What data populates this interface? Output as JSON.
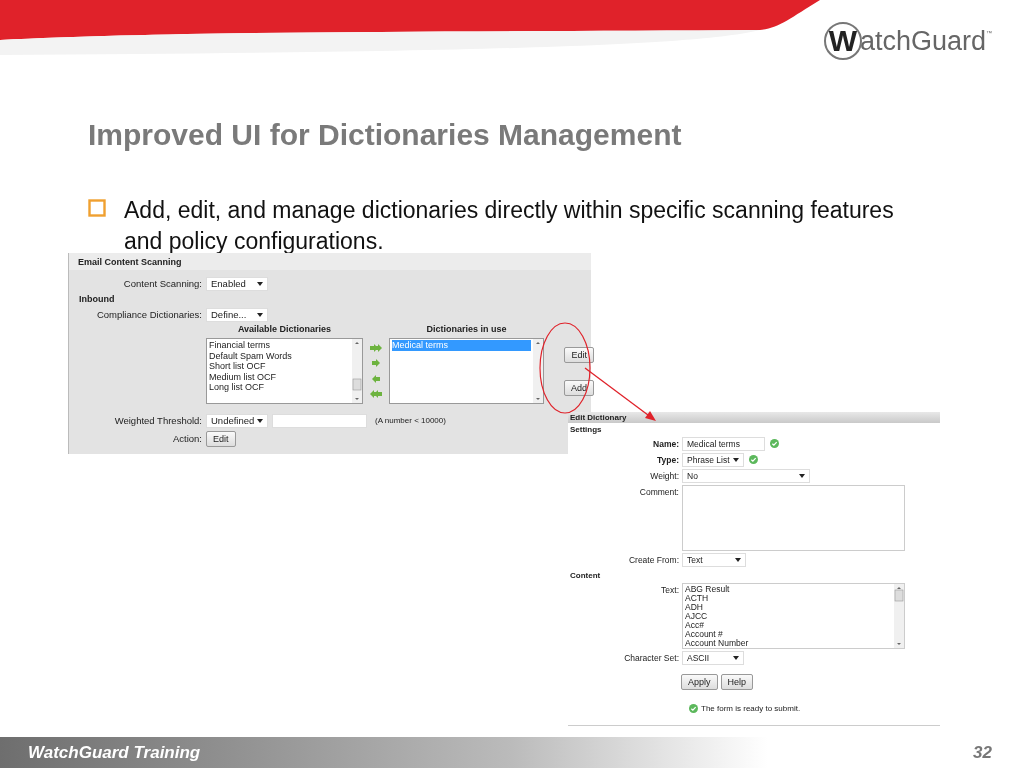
{
  "logo": {
    "letter": "W",
    "text": "atchGuard",
    "mark": "™"
  },
  "title": "Improved UI for Dictionaries Management",
  "bullet": "Add, edit, and manage dictionaries directly within specific scanning features and policy configurations.",
  "scanning": {
    "title": "Email Content Scanning",
    "rows": [
      {
        "kind": "select",
        "label": "Content Scanning:",
        "value": "Enabled"
      },
      {
        "kind": "heading",
        "label": "Inbound"
      },
      {
        "kind": "select",
        "label": "Compliance Dictionaries:",
        "value": "Define..."
      }
    ],
    "available": {
      "heading": "Available Dictionaries",
      "items": [
        {
          "label": "Financial terms",
          "selected": false
        },
        {
          "label": "Default Spam Words",
          "selected": false
        },
        {
          "label": "Short list OCF",
          "selected": false
        },
        {
          "label": "Medium list OCF",
          "selected": false
        },
        {
          "label": "Long list OCF",
          "selected": false
        }
      ]
    },
    "in_use": {
      "heading": "Dictionaries in use",
      "items": [
        {
          "label": "Medical terms",
          "selected": true
        }
      ]
    },
    "side_buttons": [
      "Edit",
      "Add"
    ],
    "threshold": {
      "label": "Weighted Threshold:",
      "value": "Undefined",
      "hint": "(A number < 10000)"
    },
    "action": {
      "label": "Action:",
      "button": "Edit"
    }
  },
  "edit": {
    "title": "Edit Dictionary",
    "settings_heading": "Settings",
    "name": {
      "label": "Name:",
      "value": "Medical terms",
      "valid": true
    },
    "type": {
      "label": "Type:",
      "value": "Phrase List",
      "valid": true
    },
    "weight": {
      "label": "Weight:",
      "value": "No"
    },
    "comment": {
      "label": "Comment:"
    },
    "create_from": {
      "label": "Create From:",
      "value": "Text"
    },
    "content_heading": "Content",
    "text": {
      "label": "Text:",
      "items": [
        "ABG Result",
        "ACTH",
        "ADH",
        "AJCC",
        "Acc#",
        "Account #",
        "Account Number"
      ]
    },
    "charset": {
      "label": "Character Set:",
      "value": "ASCII"
    },
    "buttons": [
      "Apply",
      "Help"
    ],
    "status": "The form is ready to submit."
  },
  "footer": {
    "text": "WatchGuard Training",
    "page": "32"
  }
}
